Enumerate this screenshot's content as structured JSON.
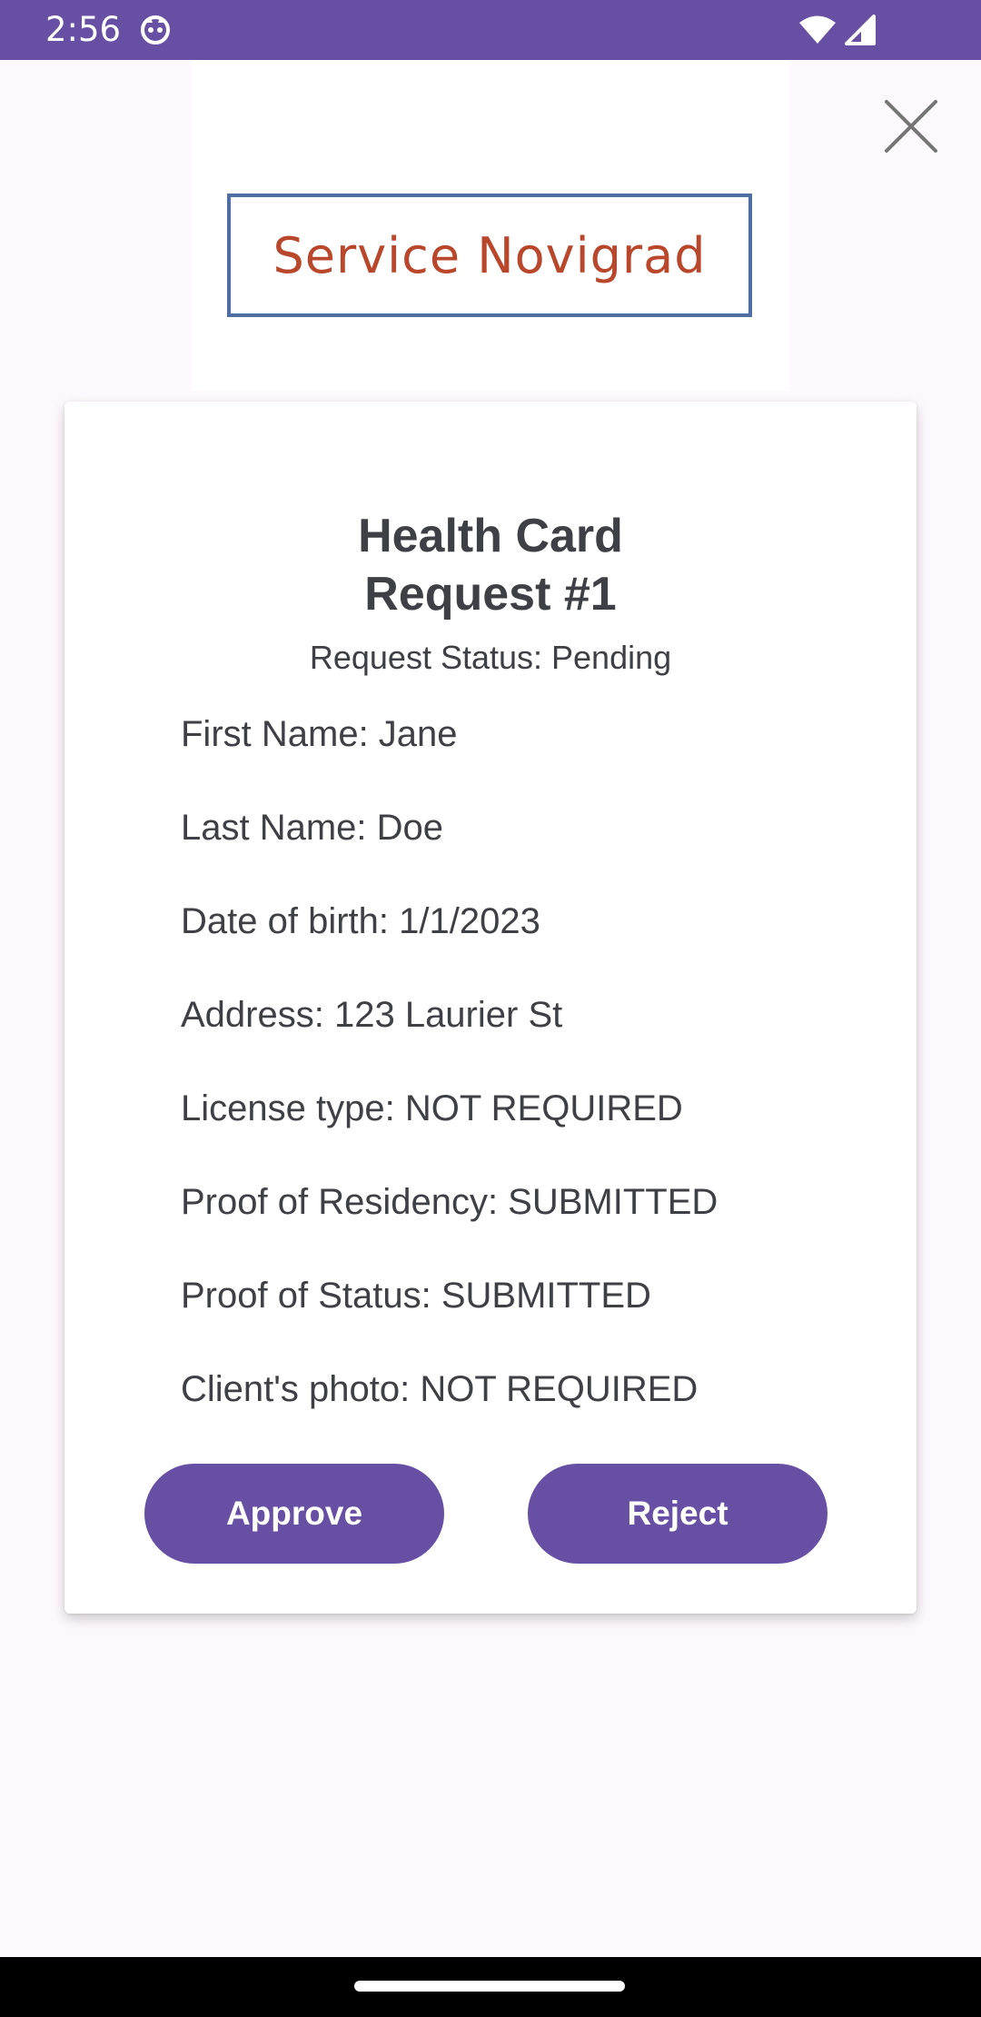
{
  "status_bar": {
    "time": "2:56",
    "icons": [
      "app-notification-icon",
      "wifi-icon",
      "signal-icon"
    ],
    "background": "#6750a4"
  },
  "logo": {
    "text": "Service Novigrad",
    "text_color": "#b9472b",
    "border_color": "#4e6ea4"
  },
  "close": {
    "icon": "close-icon"
  },
  "request": {
    "title_line1": "Health Card",
    "title_line2": "Request #1",
    "status": "Request Status: Pending",
    "fields": [
      "First Name: Jane",
      "Last Name: Doe",
      "Date of birth: 1/1/2023",
      "Address: 123 Laurier St",
      "License type: NOT REQUIRED",
      "Proof of Residency: SUBMITTED",
      "Proof of Status: SUBMITTED",
      "Client's photo: NOT REQUIRED"
    ]
  },
  "actions": {
    "approve_label": "Approve",
    "reject_label": "Reject",
    "accent": "#6750a4"
  }
}
